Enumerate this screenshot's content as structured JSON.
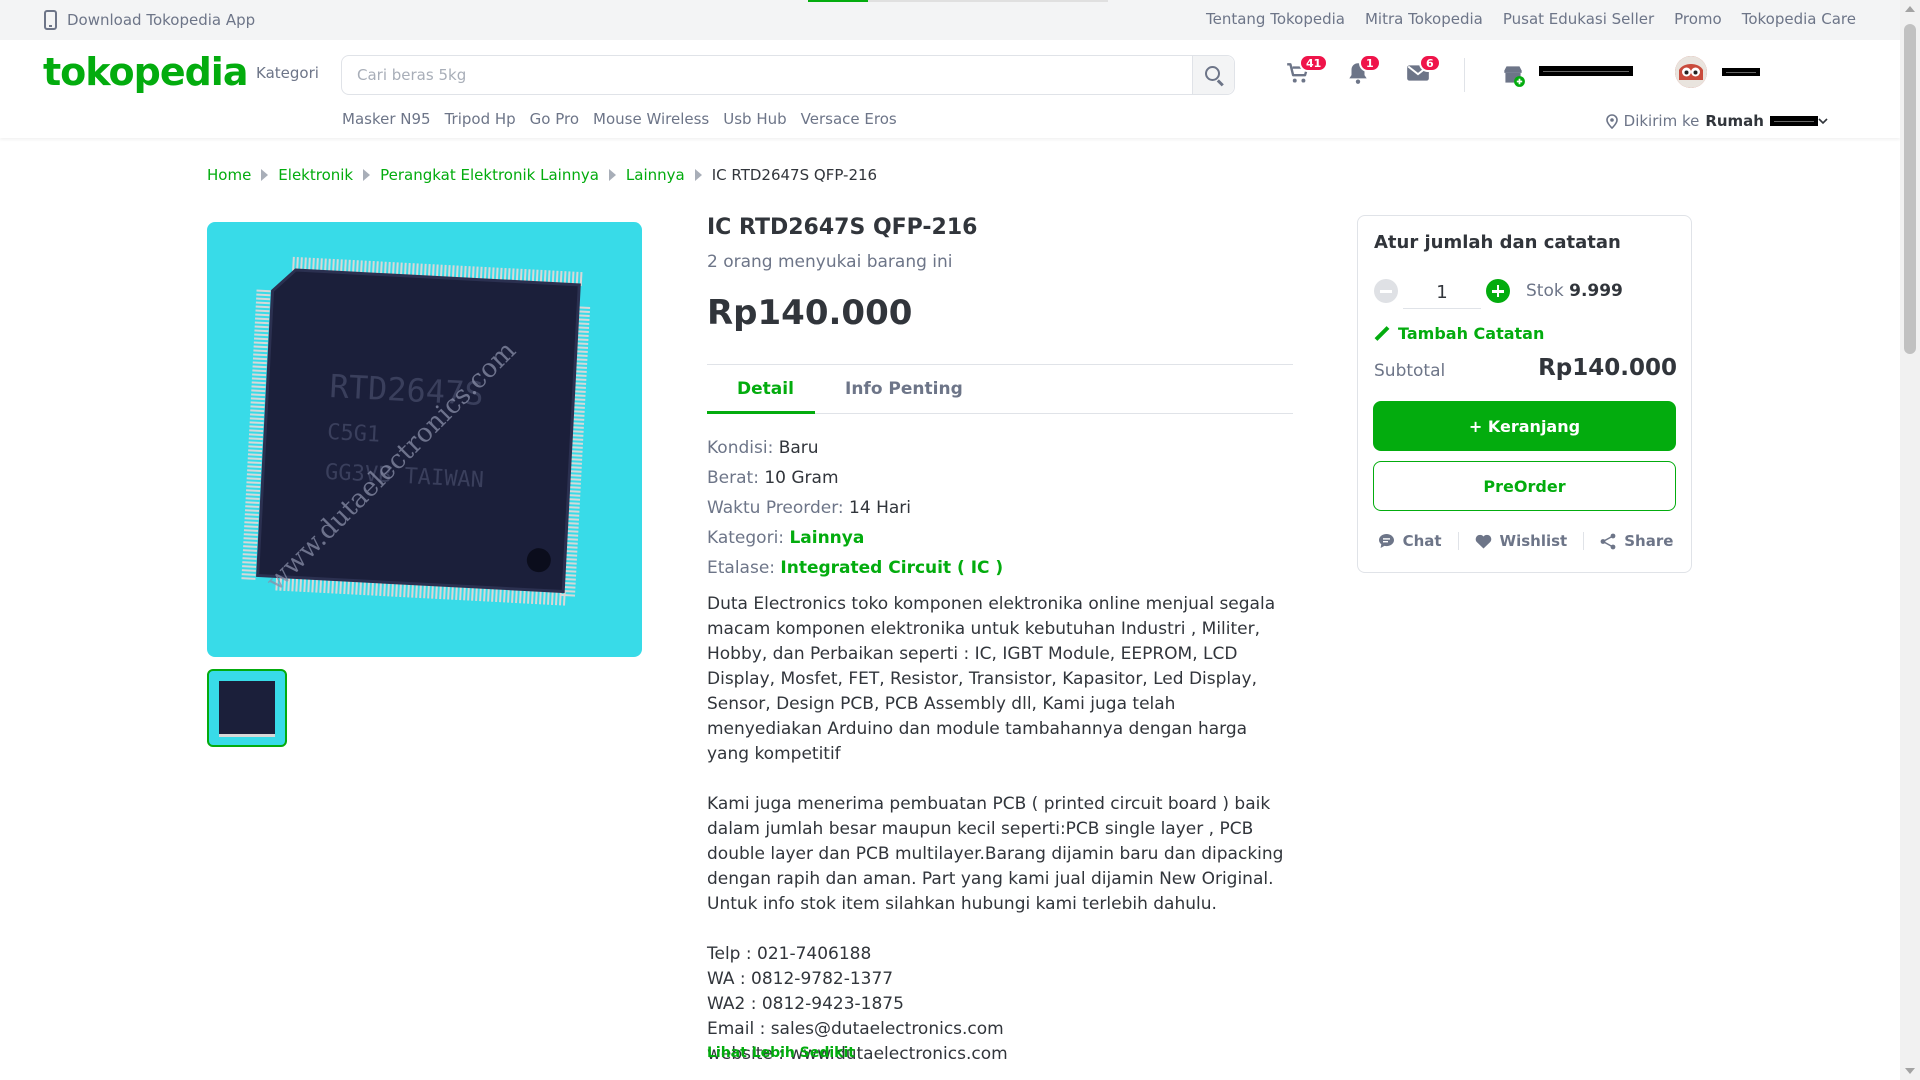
{
  "topbar": {
    "download_app": "Download Tokopedia App",
    "links": [
      "Tentang Tokopedia",
      "Mitra Tokopedia",
      "Pusat Edukasi Seller",
      "Promo",
      "Tokopedia Care"
    ]
  },
  "header": {
    "logo": "tokopedia",
    "kategori": "Kategori",
    "search_placeholder": "Cari beras 5kg",
    "suggestions": [
      "Masker N95",
      "Tripod Hp",
      "Go Pro",
      "Mouse Wireless",
      "Usb Hub",
      "Versace Eros"
    ],
    "cart_count": "41",
    "notif_count": "1",
    "inbox_count": "6",
    "dikirim_label": "Dikirim ke",
    "dikirim_place": "Rumah"
  },
  "breadcrumb": [
    "Home",
    "Elektronik",
    "Perangkat Elektronik Lainnya",
    "Lainnya"
  ],
  "breadcrumb_current": "IC RTD2647S QFP-216",
  "product": {
    "title": "IC RTD2647S QFP-216",
    "likes": "2 orang menyukai barang ini",
    "price": "Rp140.000",
    "image_chip_text": "RTD2647S",
    "image_chip_text2": "C5G1",
    "image_chip_text3": "GG3VB TAIWAN",
    "image_watermark": "www.dutaelectronics.com",
    "tabs": [
      "Detail",
      "Info Penting"
    ],
    "specs": {
      "kondisi_k": "Kondisi:",
      "kondisi_v": "Baru",
      "berat_k": "Berat:",
      "berat_v": "10 Gram",
      "preorder_k": "Waktu Preorder:",
      "preorder_v": "14 Hari",
      "kategori_k": "Kategori:",
      "kategori_v": "Lainnya",
      "etalase_k": "Etalase:",
      "etalase_v": "Integrated Circuit ( IC )"
    },
    "desc1": "Duta Electronics toko komponen elektronika online menjual segala macam komponen elektronika untuk kebutuhan Industri , Militer, Hobby, dan Perbaikan seperti : IC, IGBT Module, EEPROM, LCD Display, Mosfet, FET, Resistor, Transistor, Kapasitor, Led Display, Sensor, Design PCB, PCB Assembly dll, Kami juga telah menyediakan Arduino dan module tambahannya dengan harga yang kompetitif",
    "desc2": "Kami juga menerima pembuatan PCB ( printed circuit board ) baik dalam jumlah besar maupun kecil seperti:PCB single layer , PCB double layer dan PCB multilayer.Barang dijamin baru dan dipacking dengan rapih dan aman. Part yang kami jual dijamin New Original. Untuk info stok item silahkan hubungi kami terlebih dahulu.",
    "contact": {
      "telp": "Telp : 021-7406188",
      "wa": "WA : 0812-9782-1377",
      "wa2": "WA2 : 0812-9423-1875",
      "email": "Email : sales@dutaelectronics.com",
      "website": "website : www.dutaelectronics.com"
    },
    "lihat": "Lihat Lebih Sedikit"
  },
  "card": {
    "title": "Atur jumlah dan catatan",
    "qty": "1",
    "stok_label": "Stok",
    "stok_value": "9.999",
    "catatan": "Tambah Catatan",
    "subtotal_label": "Subtotal",
    "subtotal_value": "Rp140.000",
    "cart_btn": "+ Keranjang",
    "preorder_btn": "PreOrder",
    "chat": "Chat",
    "wishlist": "Wishlist",
    "share": "Share"
  },
  "colors": {
    "brand_green": "#03ac0e",
    "badge_red": "#ef144a",
    "image_bg": "#38dbe8"
  }
}
